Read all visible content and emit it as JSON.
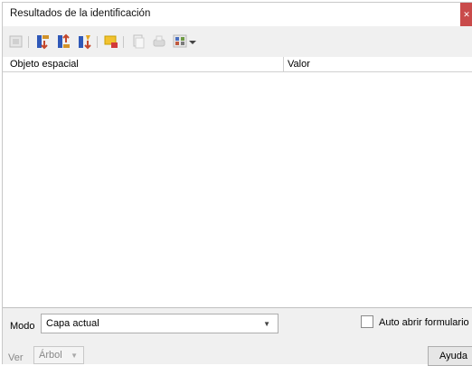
{
  "window": {
    "title": "Resultados de la identificación",
    "close_glyph": "✕"
  },
  "toolbar": {
    "icons": [
      "expand-icon",
      "expand-all-icon",
      "collapse-all-icon",
      "expand-new-icon",
      "select-features-icon",
      "copy-icon",
      "print-icon",
      "identify-options-icon",
      "dropdown-arrow-icon"
    ]
  },
  "table": {
    "columns": [
      "Objeto espacial",
      "Valor"
    ]
  },
  "footer": {
    "mode_label": "Modo",
    "mode_value": "Capa actual",
    "auto_open_label": "Auto abrir formulario",
    "view_label": "Ver",
    "view_value": "Árbol",
    "help_label": "Ayuda"
  }
}
